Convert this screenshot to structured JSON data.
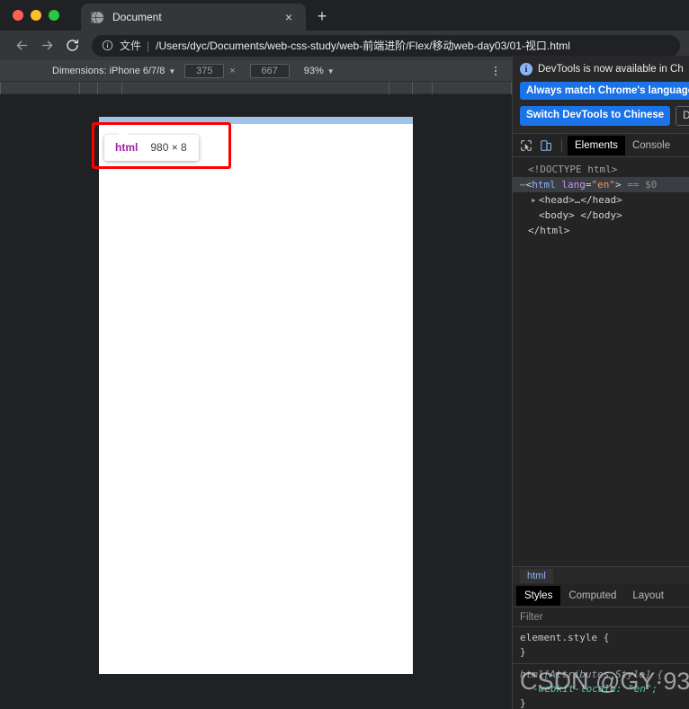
{
  "browser": {
    "tab": {
      "title": "Document",
      "favicon": "globe-icon",
      "close": "×"
    },
    "new_tab": "+",
    "nav": {
      "back": "←",
      "forward": "→",
      "reload": "↻"
    },
    "omnibox": {
      "info_icon": "i",
      "scheme_label": "文件",
      "separator": "|",
      "url": "/Users/dyc/Documents/web-css-study/web-前端进阶/Flex/移动web-day03/01-视口.html"
    }
  },
  "device_toolbar": {
    "dimensions_label": "Dimensions: iPhone 6/7/8",
    "dimensions_caret": "▼",
    "width": "375",
    "height": "667",
    "times": "×",
    "zoom": "93%",
    "zoom_caret": "▼",
    "more_icon": "vertical-dots-icon"
  },
  "viewport": {
    "highlight_color": "#a0c3e8",
    "tooltip": {
      "tag": "html",
      "size": "980 × 8"
    },
    "annotation_color": "#ff0000"
  },
  "devtools": {
    "notice": {
      "icon": "info-icon",
      "text": "DevTools is now available in Ch",
      "buttons": [
        "Always match Chrome's language",
        "Switch DevTools to Chinese",
        "Do"
      ]
    },
    "toolbar_icons": [
      "inspect-icon",
      "device-toolbar-icon"
    ],
    "tabs": [
      {
        "label": "Elements",
        "active": true
      },
      {
        "label": "Console",
        "active": false
      }
    ],
    "dom": [
      {
        "indent": 0,
        "marker": "",
        "content": "<!DOCTYPE html>",
        "type": "doctype",
        "selected": false
      },
      {
        "indent": 0,
        "marker": "⋯",
        "content": "html-open",
        "type": "element-open",
        "selected": true,
        "tag": "html",
        "attr_name": "lang",
        "attr_value": "\"en\"",
        "suffix": "== $0"
      },
      {
        "indent": 1,
        "marker": "▸",
        "content": "<head>…</head>",
        "type": "collapsed",
        "selected": false
      },
      {
        "indent": 1,
        "marker": "",
        "content": "<body> </body>",
        "type": "plain",
        "selected": false
      },
      {
        "indent": 0,
        "marker": "",
        "content": "</html>",
        "type": "plain",
        "selected": false
      }
    ],
    "breadcrumb": [
      "html"
    ],
    "sub_tabs": [
      {
        "label": "Styles",
        "active": true
      },
      {
        "label": "Computed",
        "active": false
      },
      {
        "label": "Layout",
        "active": false
      }
    ],
    "filter_placeholder": "Filter",
    "style_rules": [
      {
        "selector": "element.style {",
        "props": [],
        "close": "}",
        "inherited": false
      },
      {
        "selector": "html[Attributes Style] {",
        "props": [
          "-webkit-locale: \"en\";"
        ],
        "close": "}",
        "inherited": true
      }
    ],
    "watermark": "CSDN @GY·93"
  }
}
